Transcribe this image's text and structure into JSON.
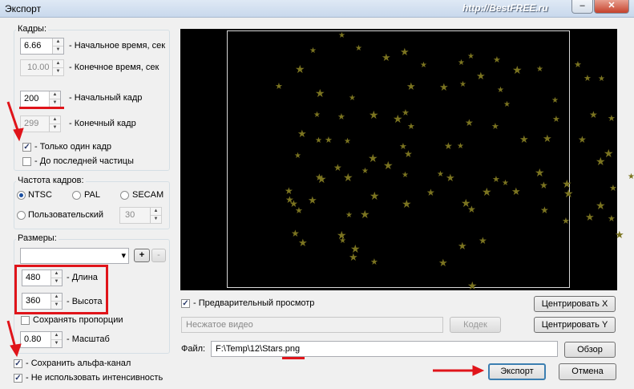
{
  "window": {
    "title": "Экспорт",
    "watermark": "http://BestFREE.ru",
    "minimize_glyph": "–",
    "maximize_glyph": "□",
    "close_glyph": "✕"
  },
  "frames": {
    "title": "Кадры:",
    "start_time": {
      "value": "6.66",
      "label": "- Начальное время, сек"
    },
    "end_time": {
      "value": "10.00",
      "label": "- Конечное время, сек"
    },
    "start_frame": {
      "value": "200",
      "label": "- Начальный кадр"
    },
    "end_frame": {
      "value": "299",
      "label": "- Конечный кадр"
    },
    "single_frame": {
      "label": "- Только один кадр",
      "checked": true
    },
    "last_particle": {
      "label": "- До последней частицы",
      "checked": false
    }
  },
  "framerate": {
    "title": "Частота кадров:",
    "options": [
      {
        "label": "NTSC",
        "selected": true
      },
      {
        "label": "PAL",
        "selected": false
      },
      {
        "label": "SECAM",
        "selected": false
      }
    ],
    "custom": {
      "label": "Пользовательский",
      "selected": false,
      "value": "30"
    }
  },
  "sizes": {
    "title": "Размеры:",
    "preset_value": "",
    "add_label": "+",
    "remove_label": "-",
    "width": {
      "value": "480",
      "label": "- Длина"
    },
    "height": {
      "value": "360",
      "label": "- Высота"
    },
    "keep_ratio": {
      "label": "Сохранять пропорции",
      "checked": false
    },
    "scale": {
      "value": "0.80",
      "label": "- Масштаб"
    }
  },
  "options": {
    "alpha": {
      "label": "- Сохранить альфа-канал",
      "checked": true
    },
    "no_intensity": {
      "label": "- Не использовать интенсивность",
      "checked": true
    }
  },
  "preview_opts": {
    "preview": {
      "label": "- Предварительный просмотр",
      "checked": true
    },
    "center_x": "Центрировать X",
    "center_y": "Центрировать Y",
    "codec_field": "Несжатое видео",
    "codec_button": "Кодек"
  },
  "file": {
    "label": "Файл:",
    "path": "F:\\Temp\\12\\Stars.png",
    "browse": "Обзор"
  },
  "actions": {
    "export": "Экспорт",
    "cancel": "Отмена"
  },
  "colors": {
    "annotation_red": "#e0141a",
    "star_yellow": "#7b7420",
    "preview_bg": "#000000"
  },
  "preview_icon": "star-icon",
  "check_glyph": "✓",
  "spin_up": "▲",
  "spin_down": "▼",
  "dropdown_glyph": "▾",
  "star_glyph": "★"
}
